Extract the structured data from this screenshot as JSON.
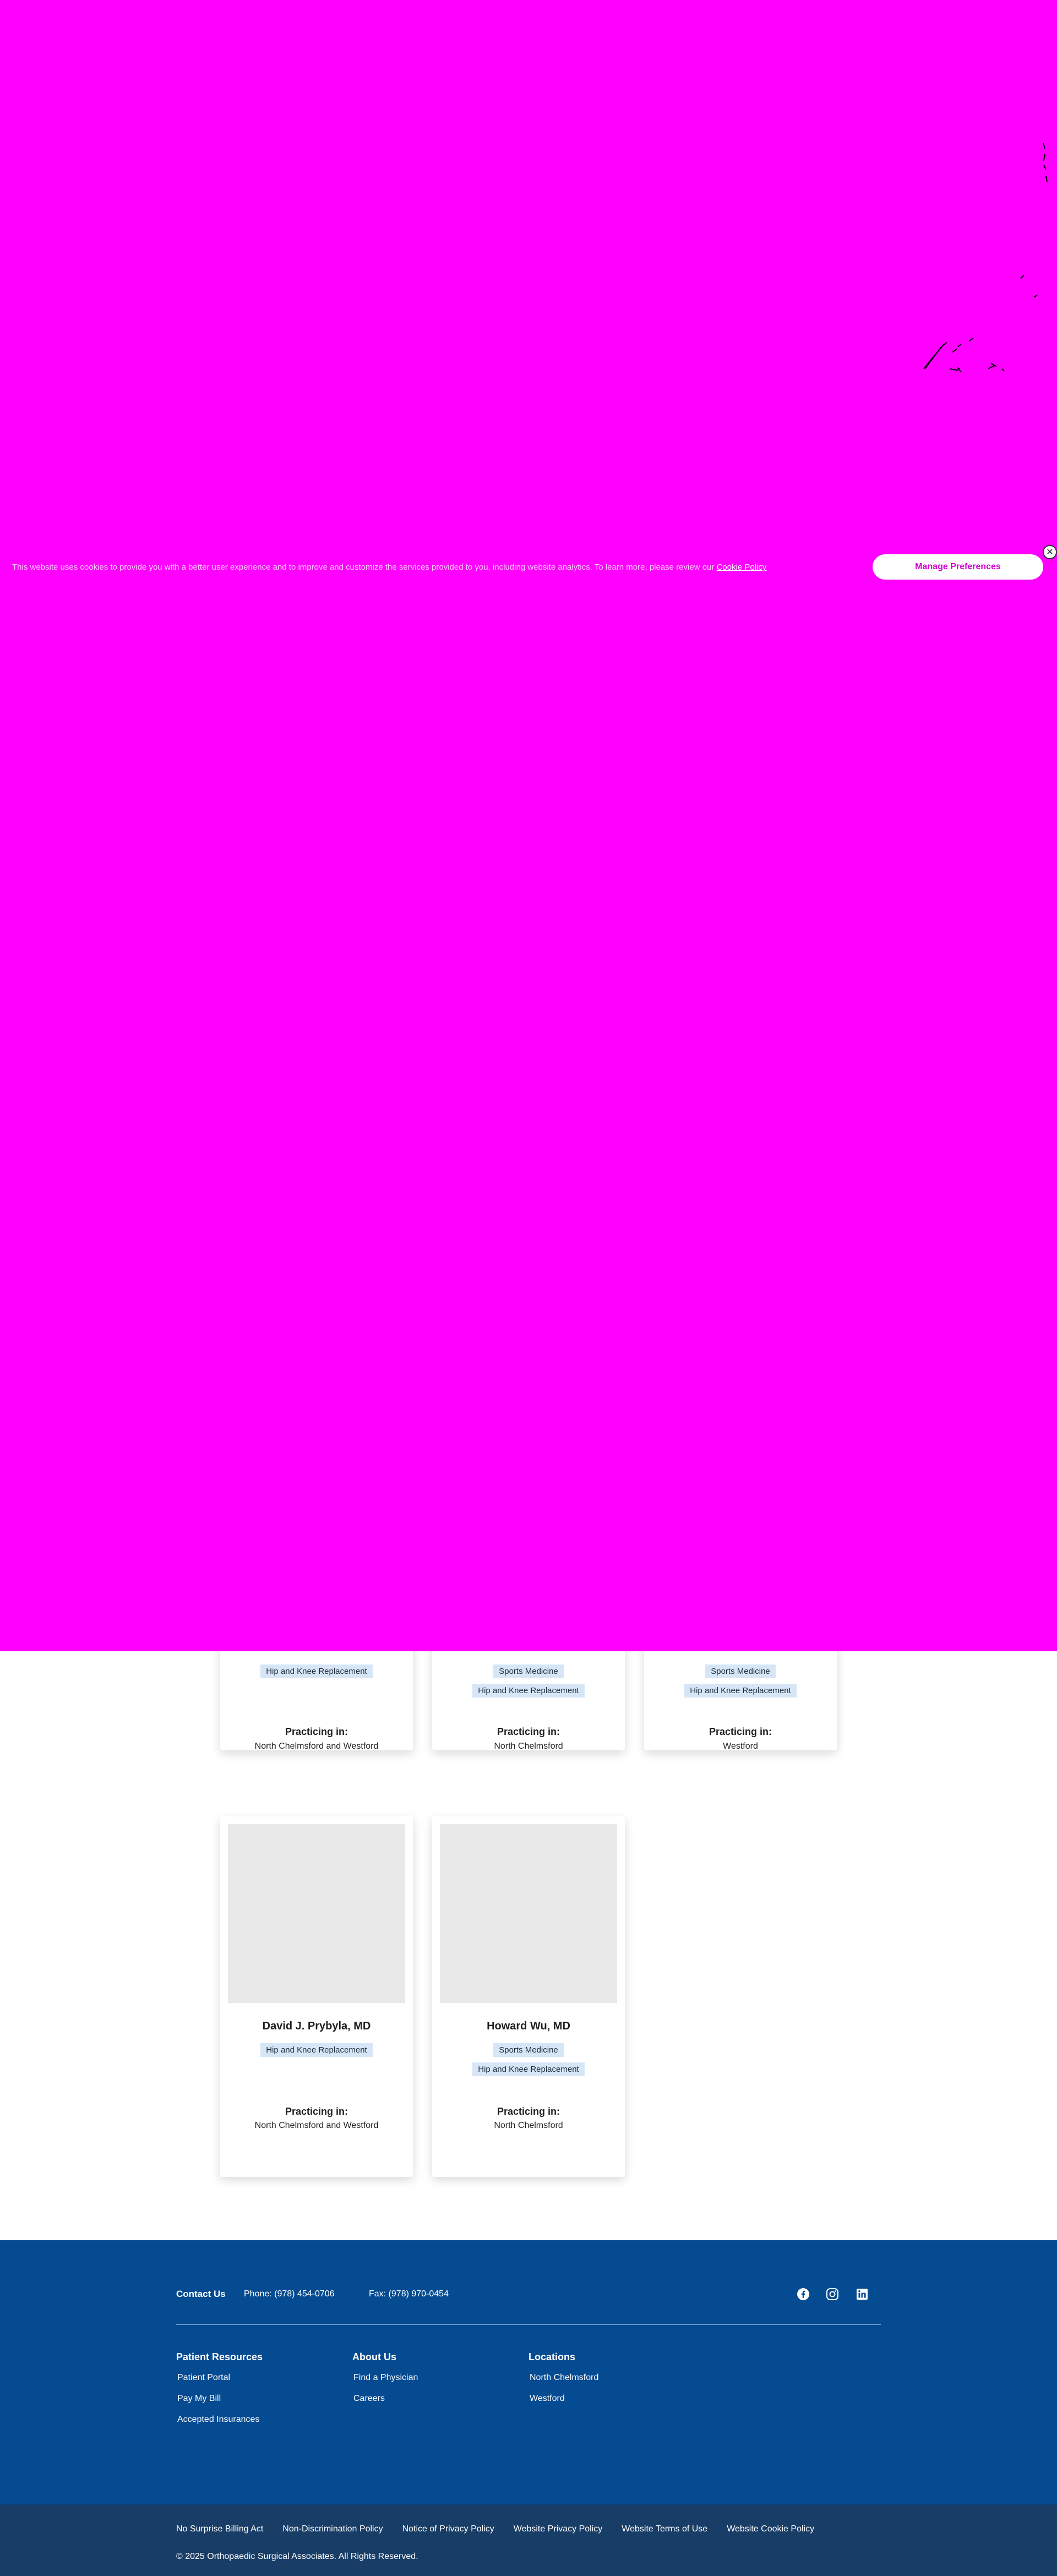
{
  "cookie_banner": {
    "message": "This website uses cookies to provide you with a better user experience and to improve and customize the services provided to you, including website analytics. To learn more, please review our",
    "policy_link": "Cookie Policy",
    "manage_button": "Manage Preferences",
    "close_icon": "close-icon"
  },
  "physicians": [
    {
      "name": "",
      "specialties": [
        "Hip and Knee Replacement"
      ],
      "practicing_label": "Practicing in:",
      "locations": "North Chelmsford and Westford"
    },
    {
      "name": "",
      "specialties": [
        "Sports Medicine",
        "Hip and Knee Replacement"
      ],
      "practicing_label": "Practicing in:",
      "locations": "North Chelmsford"
    },
    {
      "name": "",
      "specialties": [
        "Sports Medicine",
        "Hip and Knee Replacement"
      ],
      "practicing_label": "Practicing in:",
      "locations": "Westford"
    },
    {
      "name": "David J. Prybyla, MD",
      "specialties": [
        "Hip and Knee Replacement"
      ],
      "practicing_label": "Practicing in:",
      "locations": "North Chelmsford and Westford"
    },
    {
      "name": "Howard Wu, MD",
      "specialties": [
        "Sports Medicine",
        "Hip and Knee Replacement"
      ],
      "practicing_label": "Practicing in:",
      "locations": "North Chelmsford"
    }
  ],
  "footer": {
    "contact_label": "Contact Us",
    "phone": "Phone: (978) 454-0706",
    "fax": "Fax: (978) 970-0454",
    "social_icons": [
      "facebook-icon",
      "instagram-icon",
      "linkedin-icon"
    ],
    "columns": [
      {
        "title": "Patient Resources",
        "links": [
          "Patient Portal",
          "Pay My Bill",
          "Accepted Insurances"
        ]
      },
      {
        "title": "About Us",
        "links": [
          "Find a Physician",
          "Careers"
        ]
      },
      {
        "title": "Locations",
        "links": [
          "North Chelmsford",
          "Westford"
        ]
      }
    ],
    "legal_links": [
      "No Surprise Billing Act",
      "Non-Discrimination Policy",
      "Notice of Privacy Policy",
      "Website Privacy Policy",
      "Website Terms of Use",
      "Website Cookie Policy"
    ],
    "copyright": "© 2025 Orthopaedic Surgical Associates. All Rights Reserved."
  },
  "colors": {
    "overlay": "#ff00ff",
    "footer_main": "#054b91",
    "footer_bottom": "#183d66",
    "tag_bg": "#d6e6f7"
  }
}
